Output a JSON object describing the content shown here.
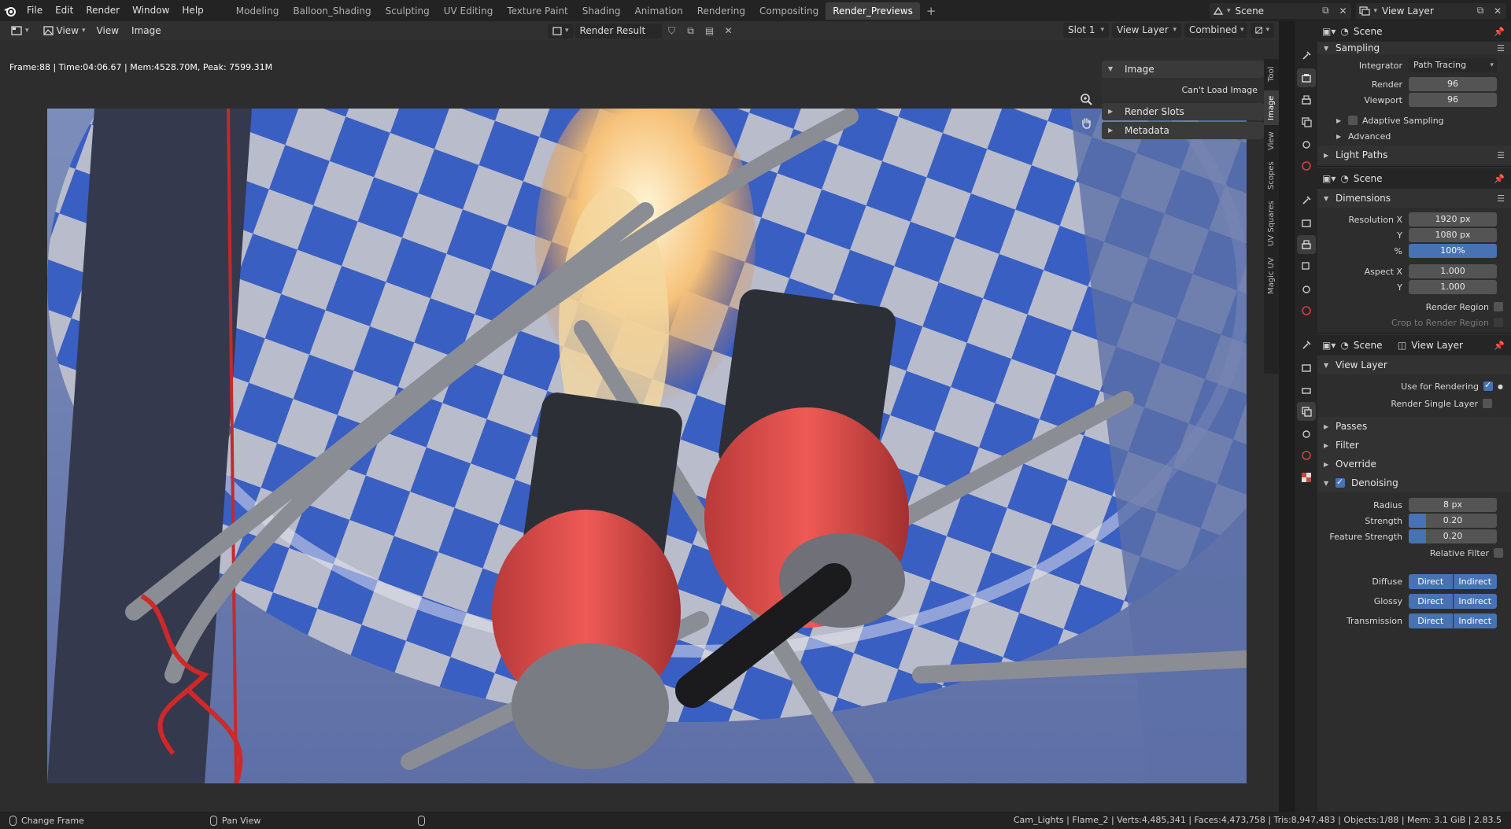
{
  "topbar": {
    "menus": [
      "File",
      "Edit",
      "Render",
      "Window",
      "Help"
    ],
    "workspaces": [
      "Modeling",
      "Balloon_Shading",
      "Sculpting",
      "UV Editing",
      "Texture Paint",
      "Shading",
      "Animation",
      "Rendering",
      "Compositing",
      "Render_Previews"
    ],
    "active_workspace": "Render_Previews",
    "add_label": "+",
    "scene": "Scene",
    "view_layer": "View Layer"
  },
  "editor": {
    "menus": [
      "View",
      "View",
      "Image"
    ],
    "image_name": "Render Result",
    "slot": "Slot 1",
    "layer": "View Layer",
    "pass": "Combined",
    "stats": "Frame:88 | Time:04:06.67 | Mem:4528.70M, Peak: 7599.31M"
  },
  "n_panel": {
    "image_header": "Image",
    "cant_load": "Can't Load Image",
    "render_slots": "Render Slots",
    "metadata": "Metadata",
    "tabs": [
      "Tool",
      "Image",
      "View",
      "Scopes",
      "UV Squares",
      "Magic UV"
    ]
  },
  "properties": {
    "render": {
      "header": "Scene",
      "sampling": "Sampling",
      "integrator_label": "Integrator",
      "integrator": "Path Tracing",
      "render_label": "Render",
      "render_samples": "96",
      "viewport_label": "Viewport",
      "viewport_samples": "96",
      "adaptive": "Adaptive Sampling",
      "advanced": "Advanced",
      "light_paths": "Light Paths"
    },
    "output": {
      "header": "Scene",
      "dimensions": "Dimensions",
      "res_x_label": "Resolution X",
      "res_x": "1920 px",
      "y_label": "Y",
      "res_y": "1080 px",
      "pct_label": "%",
      "pct": "100%",
      "aspect_x_label": "Aspect X",
      "aspect_x": "1.000",
      "aspect_y": "1.000",
      "render_region": "Render Region",
      "crop": "Crop to Render Region"
    },
    "view_layer": {
      "scene": "Scene",
      "layer": "View Layer",
      "panel": "View Layer",
      "use_for_rendering": "Use for Rendering",
      "render_single": "Render Single Layer",
      "passes": "Passes",
      "filter": "Filter",
      "override": "Override",
      "denoising": "Denoising",
      "radius_label": "Radius",
      "radius": "8 px",
      "strength_label": "Strength",
      "strength": "0.20",
      "strength_value": 0.2,
      "feature_label": "Feature Strength",
      "feature": "0.20",
      "feature_value": 0.2,
      "relative_filter": "Relative Filter",
      "diffuse": "Diffuse",
      "glossy": "Glossy",
      "transmission": "Transmission",
      "direct": "Direct",
      "indirect": "Indirect"
    }
  },
  "statusbar": {
    "change_frame": "Change Frame",
    "pan_view": "Pan View",
    "stats": "Cam_Lights | Flame_2 | Verts:4,485,341 | Faces:4,473,758 | Tris:8,947,483 | Objects:1/88 | Mem: 3.1 GiB | 2.83.5"
  },
  "colors": {
    "accent": "#4772b3",
    "background": "#2d2d2d",
    "header": "#303030"
  }
}
